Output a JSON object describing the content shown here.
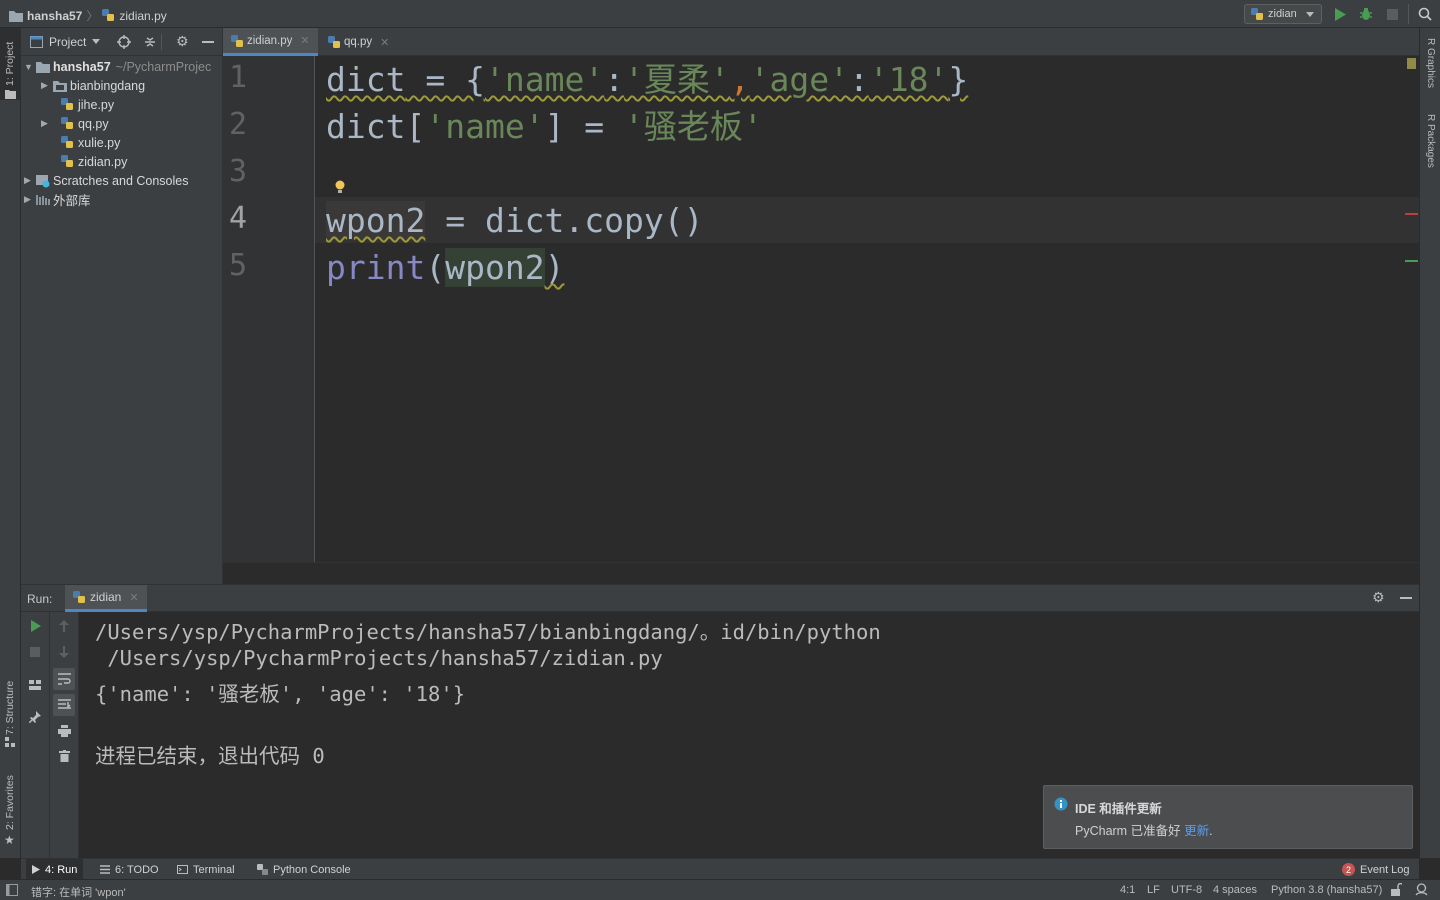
{
  "breadcrumb": {
    "project": "hansha57",
    "file": "zidian.py"
  },
  "toolbar": {
    "run_config": "zidian"
  },
  "left_strip": {
    "project_label": "1: Project",
    "structure_label": "7: Structure",
    "favorites_label": "2: Favorites"
  },
  "right_strip": {
    "r_graphics": "R Graphics",
    "r_packages": "R Packages"
  },
  "project_panel": {
    "title": "Project",
    "root": {
      "name": "hansha57",
      "path": "~/PycharmProjec"
    },
    "items": [
      {
        "label": "bianbingdang"
      },
      {
        "label": "jihe.py"
      },
      {
        "label": "qq.py"
      },
      {
        "label": "xulie.py"
      },
      {
        "label": "zidian.py"
      },
      {
        "label": "Scratches and Consoles"
      },
      {
        "label": "外部库"
      }
    ]
  },
  "tabs": [
    {
      "label": "zidian.py",
      "active": true
    },
    {
      "label": "qq.py",
      "active": false
    }
  ],
  "editor": {
    "line_numbers": [
      "1",
      "2",
      "3",
      "4",
      "5"
    ],
    "lines": [
      "dict = {'name':'夏柔','age':'18'}",
      "dict['name'] = '骚老板'",
      "",
      "wpon2 = dict.copy()",
      "print(wpon2)"
    ]
  },
  "run_panel": {
    "label": "Run:",
    "tab": "zidian",
    "output": [
      "/Users/ysp/PycharmProjects/hansha57/bianbingdang/。id/bin/python",
      " /Users/ysp/PycharmProjects/hansha57/zidian.py",
      "{'name': '骚老板', 'age': '18'}",
      "",
      "进程已结束，退出代码 0"
    ]
  },
  "notification": {
    "title": "IDE 和插件更新",
    "body": "PyCharm 已准备好",
    "link": "更新",
    "suffix": "."
  },
  "bottom_tabs": {
    "run": "4: Run",
    "todo": "6: TODO",
    "terminal": "Terminal",
    "python_console": "Python Console",
    "event_log": "Event Log",
    "event_log_count": "2"
  },
  "status_bar": {
    "message": "错字: 在单词 'wpon'",
    "position": "4:1",
    "line_sep": "LF",
    "encoding": "UTF-8",
    "indent": "4 spaces",
    "interpreter": "Python 3.8 (hansha57)"
  },
  "colors": {
    "background": "#2b2b2b",
    "panel": "#3c3f41",
    "string": "#6a8759",
    "keyword": "#cc7832",
    "builtin": "#8888c6",
    "text": "#a9b7c6",
    "link": "#589df6",
    "run_green": "#499c54"
  }
}
